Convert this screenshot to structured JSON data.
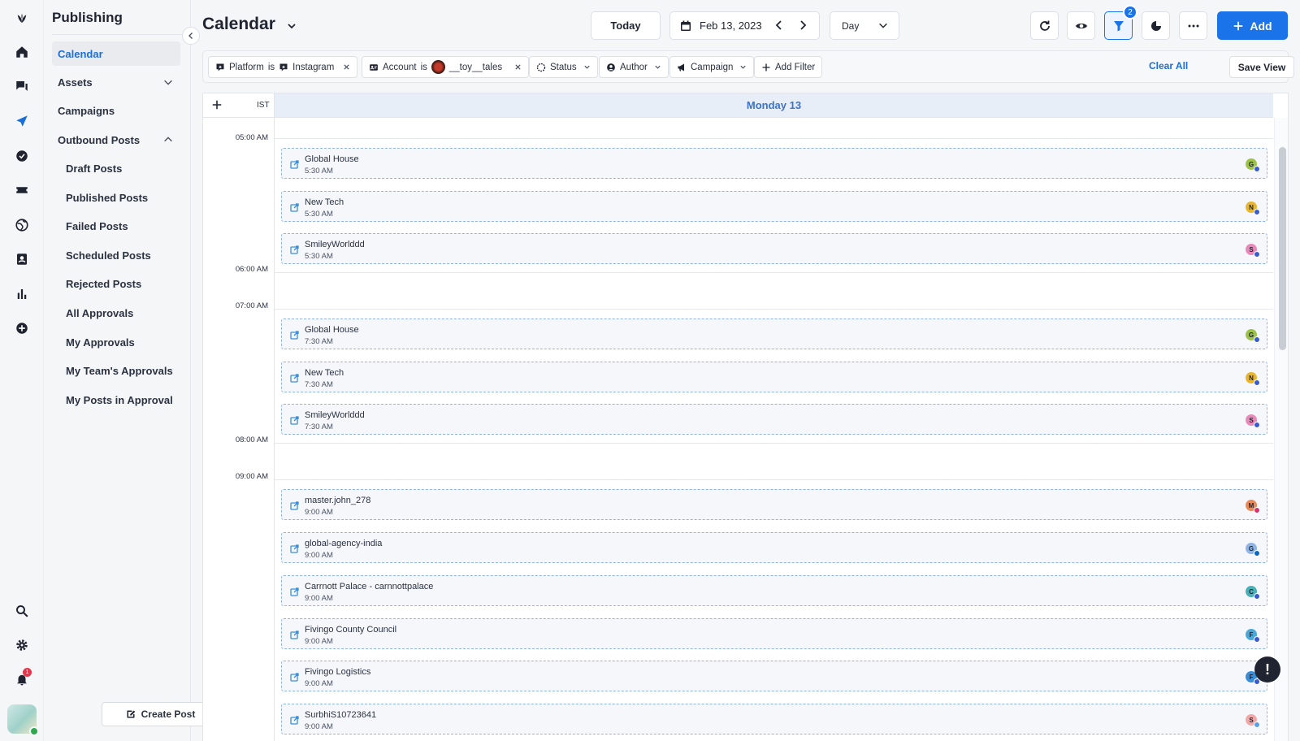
{
  "app": {
    "section_title": "Publishing"
  },
  "rail": {
    "icons": [
      "logo-icon",
      "home-icon",
      "chat-icon",
      "send-icon",
      "check-circle-icon",
      "ticket-icon",
      "globe-icon",
      "contact-card-icon",
      "bar-chart-icon",
      "plus-circle-icon",
      "search-icon",
      "gear-icon",
      "bell-icon"
    ],
    "notification_count": "1"
  },
  "sidebar": {
    "items": [
      {
        "label": "Calendar",
        "active": true
      },
      {
        "label": "Assets"
      },
      {
        "label": "Campaigns"
      },
      {
        "label": "Outbound Posts"
      }
    ],
    "sub_items": [
      "Draft Posts",
      "Published Posts",
      "Failed Posts",
      "Scheduled Posts",
      "Rejected Posts",
      "All Approvals",
      "My Approvals",
      "My Team's Approvals",
      "My Posts in Approval"
    ],
    "create_post_label": "Create Post"
  },
  "header": {
    "title": "Calendar",
    "today_label": "Today",
    "date_label": "Feb 13, 2023",
    "view_label": "Day",
    "filter_badge": "2",
    "add_label": "Add"
  },
  "filters": {
    "platform": {
      "field": "Platform",
      "op": "is",
      "value": "Instagram"
    },
    "account": {
      "field": "Account",
      "op": "is",
      "value": "__toy__tales"
    },
    "status_label": "Status",
    "author_label": "Author",
    "campaign_label": "Campaign",
    "add_filter_label": "Add Filter",
    "clear_all_label": "Clear All",
    "save_view_label": "Save View"
  },
  "calendar": {
    "timezone": "IST",
    "day_header": "Monday 13",
    "hours": [
      "05:00 AM",
      "06:00 AM",
      "07:00 AM",
      "08:00 AM",
      "09:00 AM"
    ],
    "events": [
      {
        "name": "Global House",
        "time": "5:30 AM",
        "initial": "G",
        "color": "#9cc24a"
      },
      {
        "name": "New Tech",
        "time": "5:30 AM",
        "initial": "N",
        "color": "#e8b530"
      },
      {
        "name": "SmileyWorlddd",
        "time": "5:30 AM",
        "initial": "S",
        "color": "#e88ab8"
      },
      {
        "name": "Global House",
        "time": "7:30 AM",
        "initial": "G",
        "color": "#9cc24a"
      },
      {
        "name": "New Tech",
        "time": "7:30 AM",
        "initial": "N",
        "color": "#e8b530"
      },
      {
        "name": "SmileyWorlddd",
        "time": "7:30 AM",
        "initial": "S",
        "color": "#e88ab8"
      },
      {
        "name": "master.john_278",
        "time": "9:00 AM",
        "initial": "M",
        "color": "#e88a5a"
      },
      {
        "name": "global-agency-india",
        "time": "9:00 AM",
        "initial": "G",
        "color": "#8fb5e6"
      },
      {
        "name": "Carrnott Palace - carnnottpalace",
        "time": "9:00 AM",
        "initial": "C",
        "color": "#4ab0b8"
      },
      {
        "name": "Fivingo County Council",
        "time": "9:00 AM",
        "initial": "F",
        "color": "#4aa8d8"
      },
      {
        "name": "Fivingo Logistics",
        "time": "9:00 AM",
        "initial": "F",
        "color": "#3a8ed8"
      },
      {
        "name": "SurbhiS10723641",
        "time": "9:00 AM",
        "initial": "S",
        "color": "#f0a8a8"
      }
    ]
  },
  "help_fab_label": "!"
}
